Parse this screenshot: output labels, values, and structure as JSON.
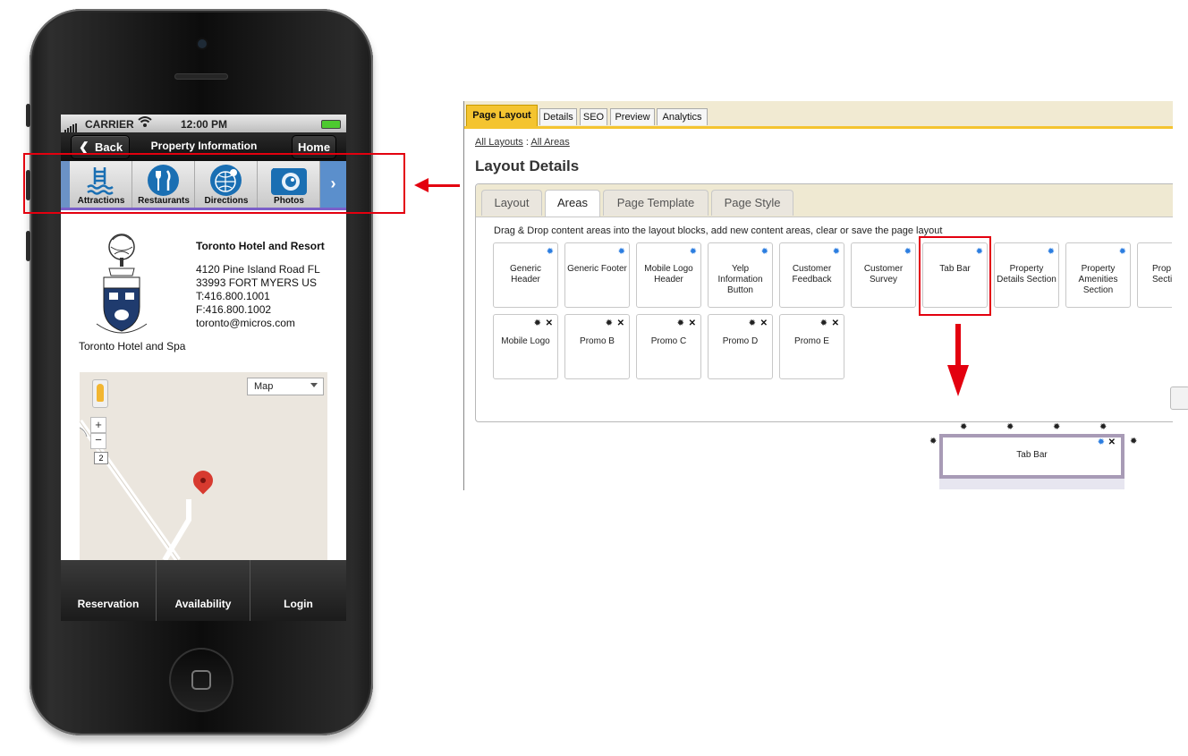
{
  "phone": {
    "status": {
      "carrier": "CARRIER",
      "time": "12:00 PM"
    },
    "nav": {
      "back_label": "Back",
      "title": "Property Information",
      "home_label": "Home"
    },
    "tabs": [
      {
        "label": "Attractions",
        "icon": "pool-ladder-icon"
      },
      {
        "label": "Restaurants",
        "icon": "fork-knife-icon"
      },
      {
        "label": "Directions",
        "icon": "globe-pin-icon"
      },
      {
        "label": "Photos",
        "icon": "camera-icon"
      }
    ],
    "hotel": {
      "name": "Toronto Hotel and Resort",
      "address_lines": [
        "4120 Pine Island Road FL",
        "33993 FORT MYERS US",
        "T:416.800.1001",
        "F:416.800.1002",
        "toronto@micros.com"
      ],
      "crest_caption": "Toronto Hotel and Spa"
    },
    "map": {
      "type_select": "Map",
      "zoom_in": "+",
      "zoom_out": "−",
      "road_number": "2"
    },
    "bottom_tabs": [
      "Reservation",
      "Availability",
      "Login"
    ]
  },
  "admin": {
    "top_tabs": [
      "Page Layout",
      "Details",
      "SEO",
      "Preview",
      "Analytics"
    ],
    "active_top_tab": "Page Layout",
    "breadcrumb": {
      "link1": "All Layouts",
      "sep": ":",
      "link2": "All Areas"
    },
    "title": "Layout Details",
    "sub_tabs": [
      "Layout",
      "Areas",
      "Page Template",
      "Page Style"
    ],
    "active_sub_tab": "Areas",
    "instruction": "Drag & Drop content areas into the layout blocks, add new content areas, clear or save the page layout",
    "areas_row1": [
      "Generic Header",
      "Generic Footer",
      "Mobile Logo Header",
      "Yelp Information Button",
      "Customer Feedback",
      "Customer Survey",
      "Tab Bar",
      "Property Details Section",
      "Property Amenities Section",
      "Prop Attrac Secti"
    ],
    "areas_row2": [
      "Mobile Logo",
      "Promo B",
      "Promo C",
      "Promo D",
      "Promo E"
    ],
    "drop_block_label": "Tab Bar"
  },
  "colors": {
    "highlight": "#e3000f",
    "tab_active": "#f4c430",
    "icon_blue": "#1a6fb3"
  }
}
